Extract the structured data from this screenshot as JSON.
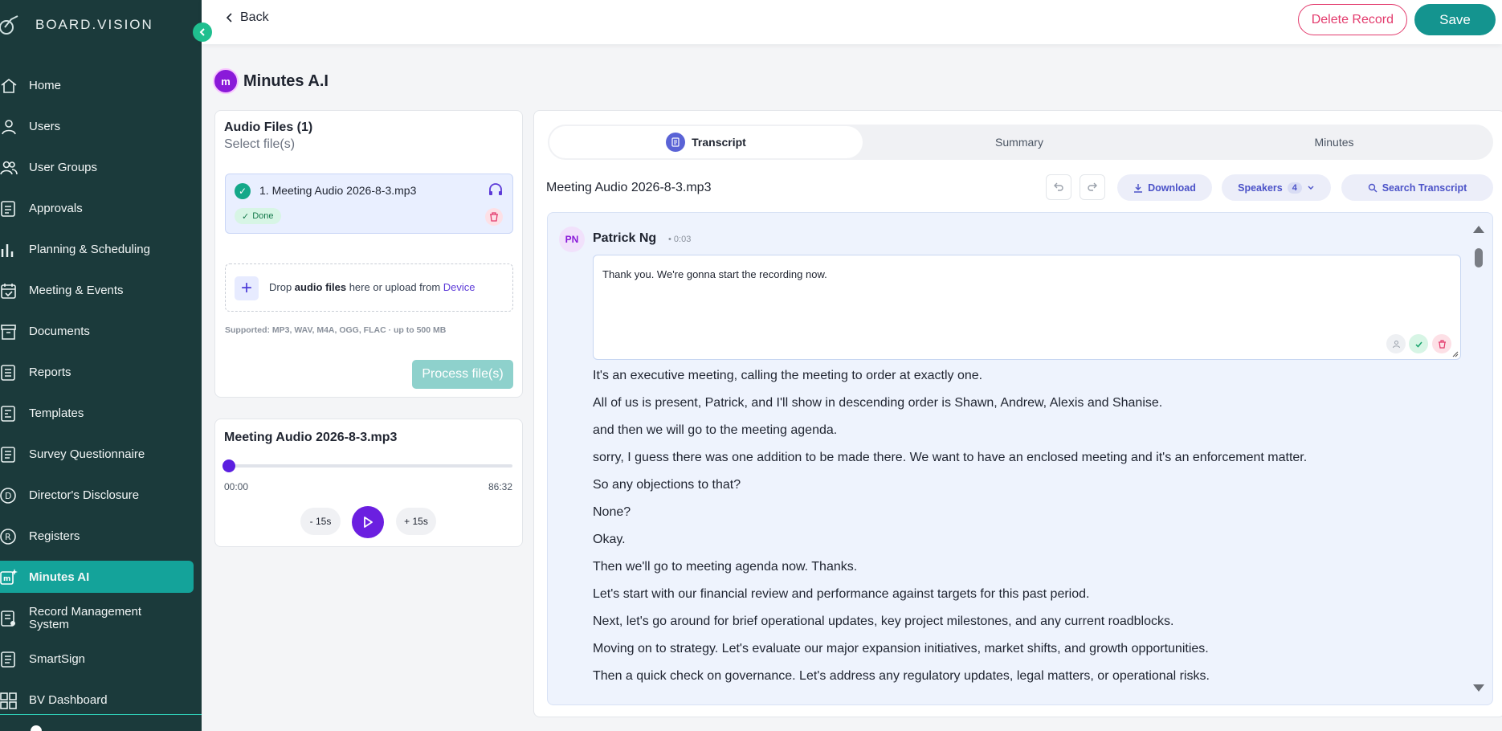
{
  "brand": {
    "name": "BOARD.VISION"
  },
  "sidebar": {
    "items": [
      {
        "label": "Home",
        "icon": "home-icon"
      },
      {
        "label": "Users",
        "icon": "user-icon"
      },
      {
        "label": "User Groups",
        "icon": "users-icon"
      },
      {
        "label": "Approvals",
        "icon": "approvals-icon"
      },
      {
        "label": "Planning & Scheduling",
        "icon": "bar-chart-icon"
      },
      {
        "label": "Meeting & Events",
        "icon": "calendar-icon"
      },
      {
        "label": "Documents",
        "icon": "archive-icon"
      },
      {
        "label": "Reports",
        "icon": "report-icon"
      },
      {
        "label": "Templates",
        "icon": "template-icon"
      },
      {
        "label": "Survey Questionnaire",
        "icon": "survey-icon"
      },
      {
        "label": "Director's Disclosure",
        "icon": "d-circle-icon"
      },
      {
        "label": "Registers",
        "icon": "r-circle-icon"
      },
      {
        "label": "Minutes AI",
        "icon": "minutes-ai-icon",
        "active": true
      },
      {
        "label": "Record Management System",
        "icon": "record-icon"
      },
      {
        "label": "SmartSign",
        "icon": "smartsign-icon"
      },
      {
        "label": "BV Dashboard",
        "icon": "grid-icon"
      }
    ]
  },
  "topbar": {
    "back_label": "Back",
    "delete_label": "Delete Record",
    "save_label": "Save"
  },
  "page": {
    "title": "Minutes A.I",
    "logo_letter": "m"
  },
  "files": {
    "title": "Audio Files (1)",
    "subtitle": "Select file(s)",
    "items": [
      {
        "name": "1. Meeting Audio 2026-8-3.mp3",
        "status": "Done"
      }
    ],
    "drop_prefix": "Drop ",
    "drop_bold": "audio files",
    "drop_mid": " here or upload from ",
    "drop_link": "Device",
    "supported": "Supported: MP3, WAV, M4A, OGG, FLAC · up to 500 MB",
    "process_label": "Process file(s)"
  },
  "player": {
    "title": "Meeting Audio 2026-8-3.mp3",
    "current": "00:00",
    "duration": "86:32",
    "progress": 0,
    "back_label": "- 15s",
    "fwd_label": "+ 15s"
  },
  "tabs": [
    {
      "label": "Transcript",
      "active": true
    },
    {
      "label": "Summary"
    },
    {
      "label": "Minutes"
    }
  ],
  "transcript": {
    "recording_name": "Meeting Audio 2026-8-3.mp3",
    "download_label": "Download",
    "speakers_label": "Speakers",
    "speakers_count": "4",
    "search_label": "Search Transcript",
    "speaker": {
      "initials": "PN",
      "name": "Patrick Ng",
      "time": "• 0:03"
    },
    "editing_text": "Thank you. We're gonna start the recording now.",
    "lines": [
      "It's an executive meeting, calling the meeting to order at exactly one.",
      "All of us is present, Patrick, and I'll show in descending order is Shawn, Andrew, Alexis and Shanise.",
      "and then we will go to the meeting agenda.",
      "sorry, I guess there was one addition to be made there. We want to have an enclosed meeting and it's an enforcement matter.",
      "So any objections to that?",
      "None?",
      "Okay.",
      "Then we'll go to meeting agenda now. Thanks.",
      "Let's start with our financial review and performance against targets for this past period.",
      "Next, let's go around for brief operational updates, key project milestones, and any current roadblocks.",
      "Moving on to strategy. Let's evaluate our major expansion initiatives, market shifts, and growth opportunities.",
      "Then a quick check on governance. Let's address any regulatory updates, legal matters, or operational risks."
    ]
  },
  "colors": {
    "sidebar": "#1b3a3b",
    "accent": "#14948f",
    "danger": "#e33b6d",
    "purple": "#6b1fe0"
  }
}
